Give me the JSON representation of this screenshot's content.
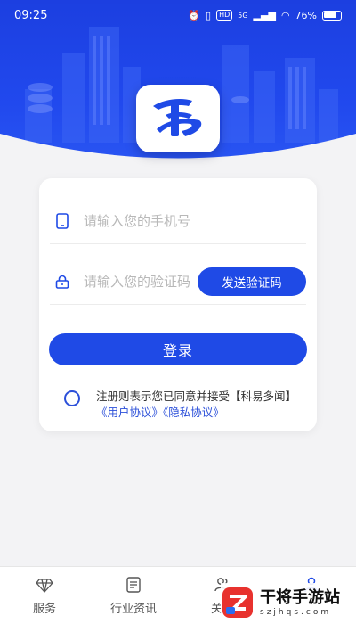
{
  "status_bar": {
    "time": "09:25",
    "network_badge": "HD",
    "signal_label": "5G",
    "battery": "76%"
  },
  "form": {
    "phone_placeholder": "请输入您的手机号",
    "code_placeholder": "请输入您的验证码",
    "send_code_label": "发送验证码",
    "login_label": "登录",
    "agreement_prefix": "注册则表示您已同意并接受【科易多闻】",
    "user_agreement_link": "《用户协议》",
    "privacy_link": "《隐私协议》"
  },
  "tabs": [
    {
      "label": "服务",
      "icon": "diamond-icon"
    },
    {
      "label": "行业资讯",
      "icon": "news-icon"
    },
    {
      "label": "关于",
      "icon": "people-icon"
    },
    {
      "label": "",
      "icon": "user-icon"
    }
  ],
  "watermark": {
    "title": "干将手游站",
    "subtitle": "szjhqs.com"
  },
  "colors": {
    "primary": "#1f4ae6",
    "hero": "#2149ee",
    "background": "#f3f3f5"
  }
}
